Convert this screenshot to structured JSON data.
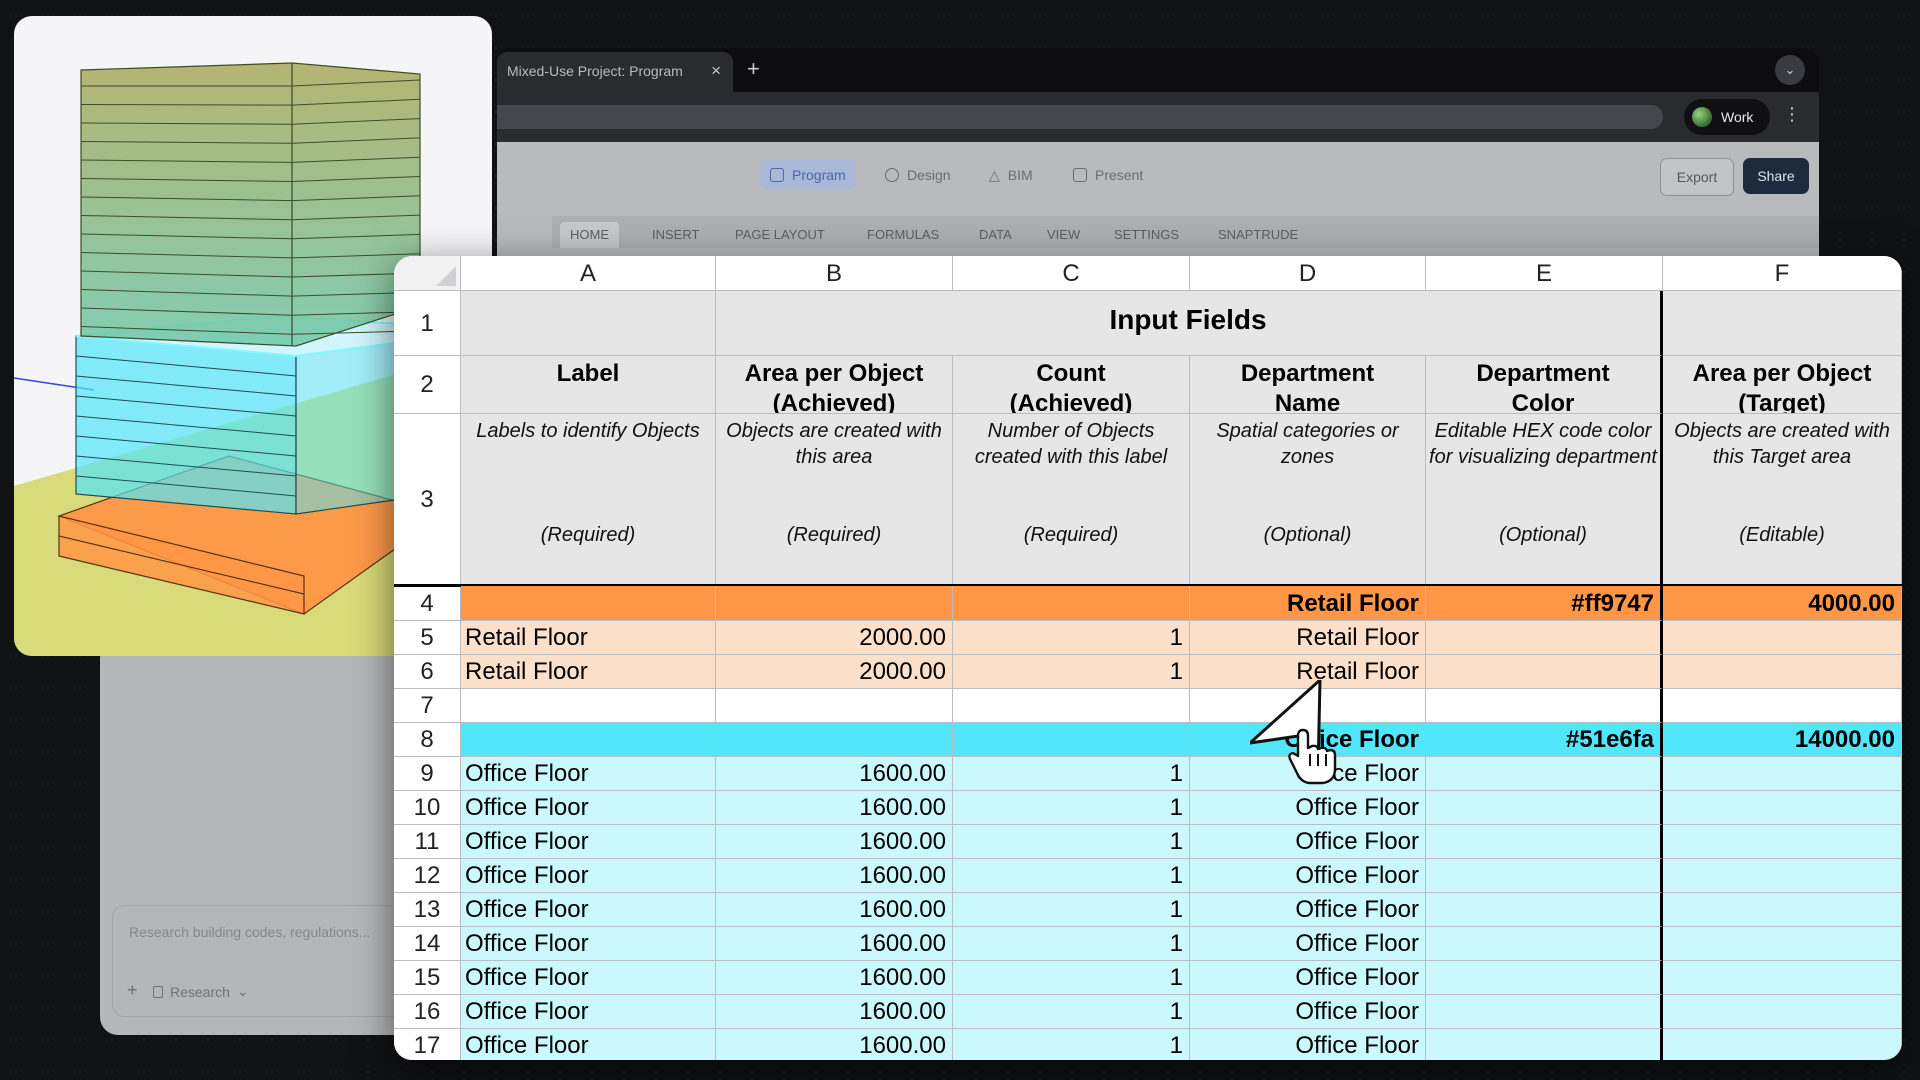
{
  "browser": {
    "tab_title": "Mixed-Use Project: Program",
    "tab_close": "×",
    "new_tab": "+",
    "profile_label": "Work",
    "menu": "⋮",
    "dropdown": "⌄"
  },
  "app": {
    "modes": [
      {
        "label": "Program",
        "active": true
      },
      {
        "label": "Design",
        "active": false
      },
      {
        "label": "BIM",
        "active": false
      },
      {
        "label": "Present",
        "active": false
      }
    ],
    "export_label": "Export",
    "share_label": "Share",
    "ribbon_tabs": [
      "HOME",
      "INSERT",
      "PAGE LAYOUT",
      "FORMULAS",
      "DATA",
      "VIEW",
      "SETTINGS",
      "SNAPTRUDE"
    ]
  },
  "chat": {
    "placeholder": "Research building codes, regulations...",
    "add": "+",
    "research_label": "Research",
    "research_caret": "⌄"
  },
  "sheet": {
    "columns": [
      "A",
      "B",
      "C",
      "D",
      "E",
      "F"
    ],
    "row_numbers": [
      "1",
      "2",
      "3",
      "4",
      "5",
      "6",
      "7",
      "8",
      "9",
      "10",
      "11",
      "12",
      "13",
      "14",
      "15",
      "16",
      "17"
    ],
    "title": "Input Fields",
    "headers": [
      [
        "Label"
      ],
      [
        "Area per Object",
        "(Achieved)"
      ],
      [
        "Count",
        "(Achieved)"
      ],
      [
        "Department",
        "Name"
      ],
      [
        "Department",
        "Color"
      ],
      [
        "Area per Object",
        "(Target)"
      ]
    ],
    "descriptions": [
      {
        "text": "Labels to identify Objects",
        "tag": "(Required)"
      },
      {
        "text": "Objects are created with this area",
        "tag": "(Required)"
      },
      {
        "text": "Number of Objects created with this label",
        "tag": "(Required)"
      },
      {
        "text": "Spatial categories or zones",
        "tag": "(Optional)"
      },
      {
        "text": "Editable HEX code color for visualizing department",
        "tag": "(Optional)"
      },
      {
        "text": "Objects are created with this Target area",
        "tag": "(Editable)"
      }
    ],
    "rows": [
      {
        "kind": "dept",
        "color": "#ff9747",
        "cells": [
          "",
          "",
          "",
          "Retail Floor",
          "#ff9747",
          "4000.00"
        ]
      },
      {
        "kind": "item",
        "color": "#fde0c9",
        "cells": [
          "Retail Floor",
          "2000.00",
          "1",
          "Retail Floor",
          "",
          ""
        ]
      },
      {
        "kind": "item",
        "color": "#fde0c9",
        "cells": [
          "Retail Floor",
          "2000.00",
          "1",
          "Retail Floor",
          "",
          ""
        ]
      },
      {
        "kind": "blank",
        "color": "#ffffff",
        "cells": [
          "",
          "",
          "",
          "",
          "",
          ""
        ]
      },
      {
        "kind": "dept",
        "color": "#51e6fa",
        "cells": [
          "",
          "",
          "",
          "Office Floor",
          "#51e6fa",
          "14000.00"
        ]
      },
      {
        "kind": "item",
        "color": "#cbf8fc",
        "cells": [
          "Office Floor",
          "1600.00",
          "1",
          "Office Floor",
          "",
          ""
        ]
      },
      {
        "kind": "item",
        "color": "#cbf8fc",
        "cells": [
          "Office Floor",
          "1600.00",
          "1",
          "Office Floor",
          "",
          ""
        ]
      },
      {
        "kind": "item",
        "color": "#cbf8fc",
        "cells": [
          "Office Floor",
          "1600.00",
          "1",
          "Office Floor",
          "",
          ""
        ]
      },
      {
        "kind": "item",
        "color": "#cbf8fc",
        "cells": [
          "Office Floor",
          "1600.00",
          "1",
          "Office Floor",
          "",
          ""
        ]
      },
      {
        "kind": "item",
        "color": "#cbf8fc",
        "cells": [
          "Office Floor",
          "1600.00",
          "1",
          "Office Floor",
          "",
          ""
        ]
      },
      {
        "kind": "item",
        "color": "#cbf8fc",
        "cells": [
          "Office Floor",
          "1600.00",
          "1",
          "Office Floor",
          "",
          ""
        ]
      },
      {
        "kind": "item",
        "color": "#cbf8fc",
        "cells": [
          "Office Floor",
          "1600.00",
          "1",
          "Office Floor",
          "",
          ""
        ]
      },
      {
        "kind": "item",
        "color": "#cbf8fc",
        "cells": [
          "Office Floor",
          "1600.00",
          "1",
          "Office Floor",
          "",
          ""
        ]
      },
      {
        "kind": "item",
        "color": "#cbf8fc",
        "cells": [
          "Office Floor",
          "1600.00",
          "1",
          "Office Floor",
          "",
          ""
        ]
      }
    ]
  },
  "model": {
    "retail_color": "#ff9747",
    "office_color": "#51e6fa",
    "upper_color": "#9aae3e",
    "ground_color": "#d9da7a"
  }
}
